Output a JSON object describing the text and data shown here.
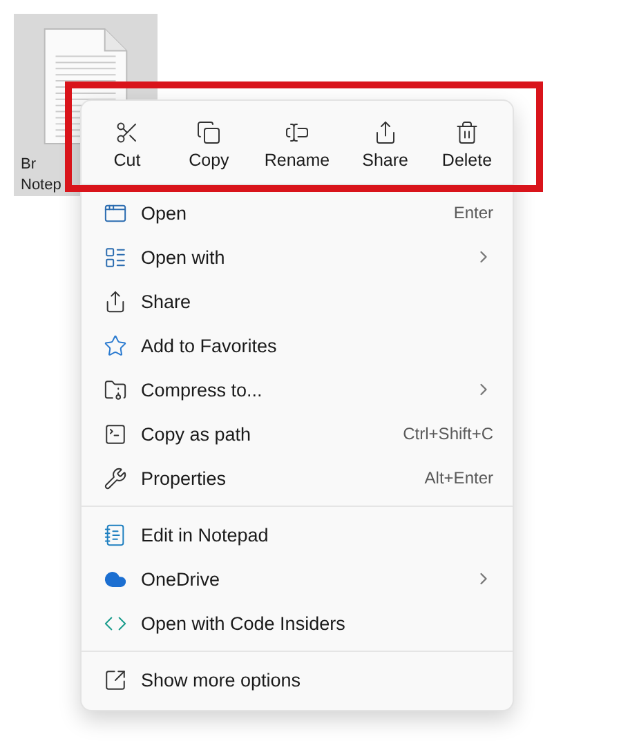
{
  "desktop_file": {
    "label_lines": [
      "Br",
      "Notep"
    ]
  },
  "toolbar": [
    {
      "label": "Cut"
    },
    {
      "label": "Copy"
    },
    {
      "label": "Rename"
    },
    {
      "label": "Share"
    },
    {
      "label": "Delete"
    }
  ],
  "groups": [
    [
      {
        "label": "Open",
        "shortcut": "Enter",
        "submenu": false
      },
      {
        "label": "Open with",
        "submenu": true
      },
      {
        "label": "Share",
        "submenu": false
      },
      {
        "label": "Add to Favorites",
        "submenu": false
      },
      {
        "label": "Compress to...",
        "submenu": true
      },
      {
        "label": "Copy as path",
        "shortcut": "Ctrl+Shift+C",
        "submenu": false
      },
      {
        "label": "Properties",
        "shortcut": "Alt+Enter",
        "submenu": false
      }
    ],
    [
      {
        "label": "Edit in Notepad",
        "submenu": false
      },
      {
        "label": "OneDrive",
        "submenu": true
      },
      {
        "label": "Open with Code Insiders",
        "submenu": false
      }
    ],
    [
      {
        "label": "Show more options",
        "submenu": false
      }
    ]
  ]
}
